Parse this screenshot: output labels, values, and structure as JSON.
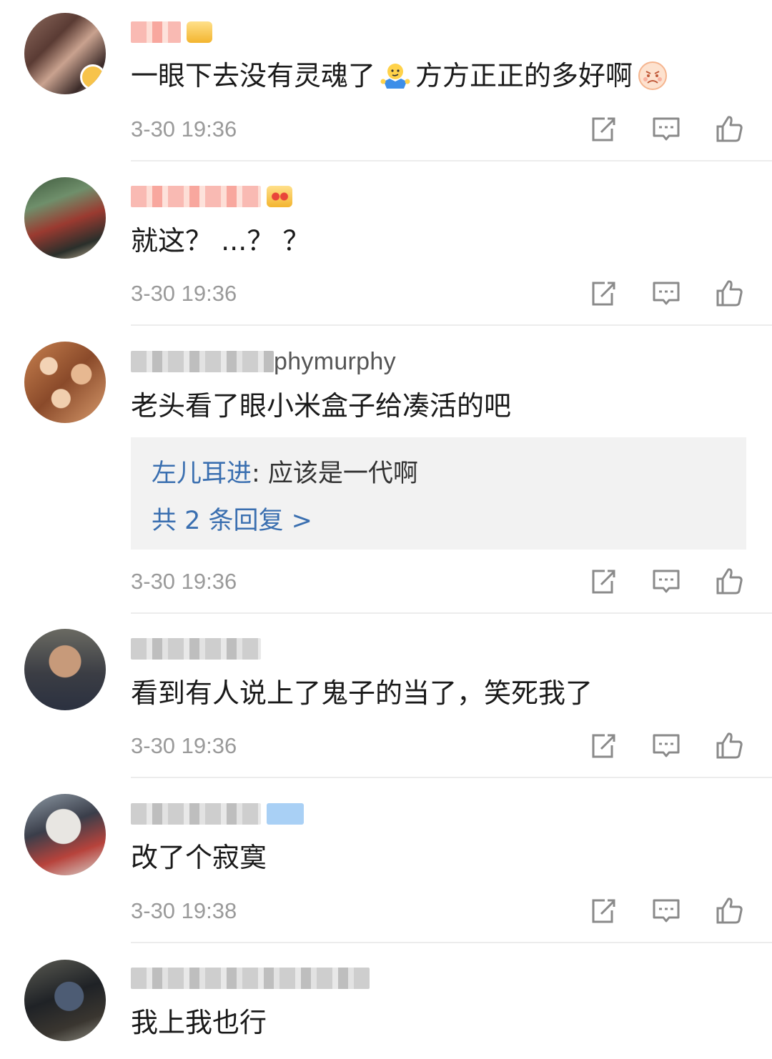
{
  "comments": [
    {
      "username": "",
      "body": "一眼下去没有灵魂了",
      "body_after": "方方正正的多好啊",
      "emoji_1": "shrug-emoji",
      "emoji_2": "angry-face-emoji",
      "time": "3-30 19:36"
    },
    {
      "username": "",
      "body": "就这？ ...？ ？",
      "time": "3-30 19:36"
    },
    {
      "username": "phymurphy",
      "body": "老头看了眼小米盒子给凑活的吧",
      "reply": {
        "user": "左儿耳进",
        "text": ": 应该是一代啊",
        "more": "共 2 条回复 >"
      },
      "time": "3-30 19:36"
    },
    {
      "username": "",
      "body": "看到有人说上了鬼子的当了，笑死我了",
      "time": "3-30 19:36"
    },
    {
      "username": "",
      "body": "改了个寂寞",
      "time": "3-30 19:38"
    },
    {
      "username": "",
      "body": "我上我也行",
      "time": ""
    }
  ],
  "icons": {
    "share": "share-icon",
    "comment": "comment-icon",
    "like": "thumbs-up-icon"
  },
  "colors": {
    "link_blue": "#3a6fb0",
    "meta_gray": "#9a9a9a",
    "reply_bg": "#f2f2f2"
  }
}
